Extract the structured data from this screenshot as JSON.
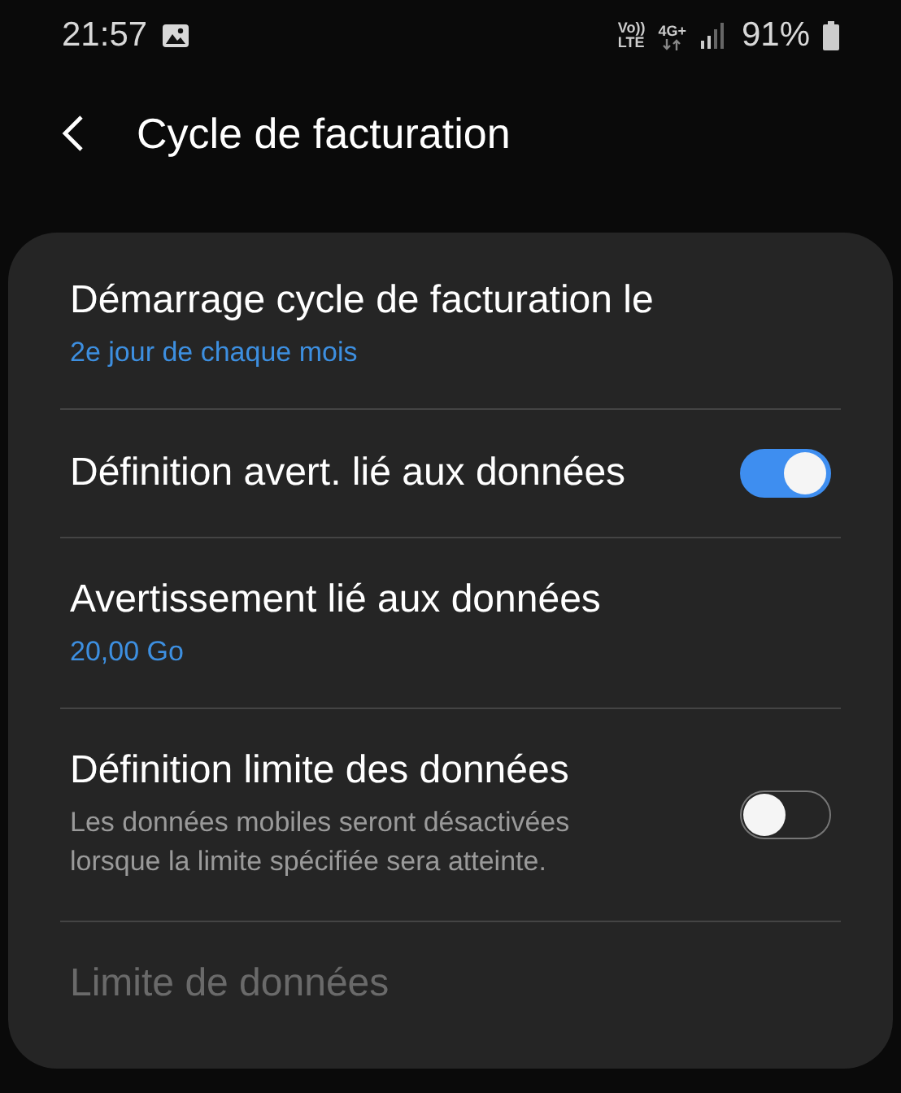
{
  "status_bar": {
    "time": "21:57",
    "volte_top": "Vo))",
    "volte_bottom": "LTE",
    "network": "4G+",
    "battery_text": "91%"
  },
  "header": {
    "title": "Cycle de facturation"
  },
  "items": [
    {
      "kind": "value",
      "title": "Démarrage cycle de facturation le",
      "value": "2e jour de chaque mois",
      "disabled": false
    },
    {
      "kind": "switch",
      "title": "Définition avert. lié aux données",
      "on": true,
      "disabled": false
    },
    {
      "kind": "value",
      "title": "Avertissement lié aux données",
      "value": "20,00 Go",
      "disabled": false
    },
    {
      "kind": "switch",
      "title": "Définition limite des données",
      "description": "Les données mobiles seront désactivées lorsque la limite spécifiée sera atteinte.",
      "on": false,
      "disabled": false
    },
    {
      "kind": "value",
      "title": "Limite de données",
      "disabled": true
    }
  ]
}
